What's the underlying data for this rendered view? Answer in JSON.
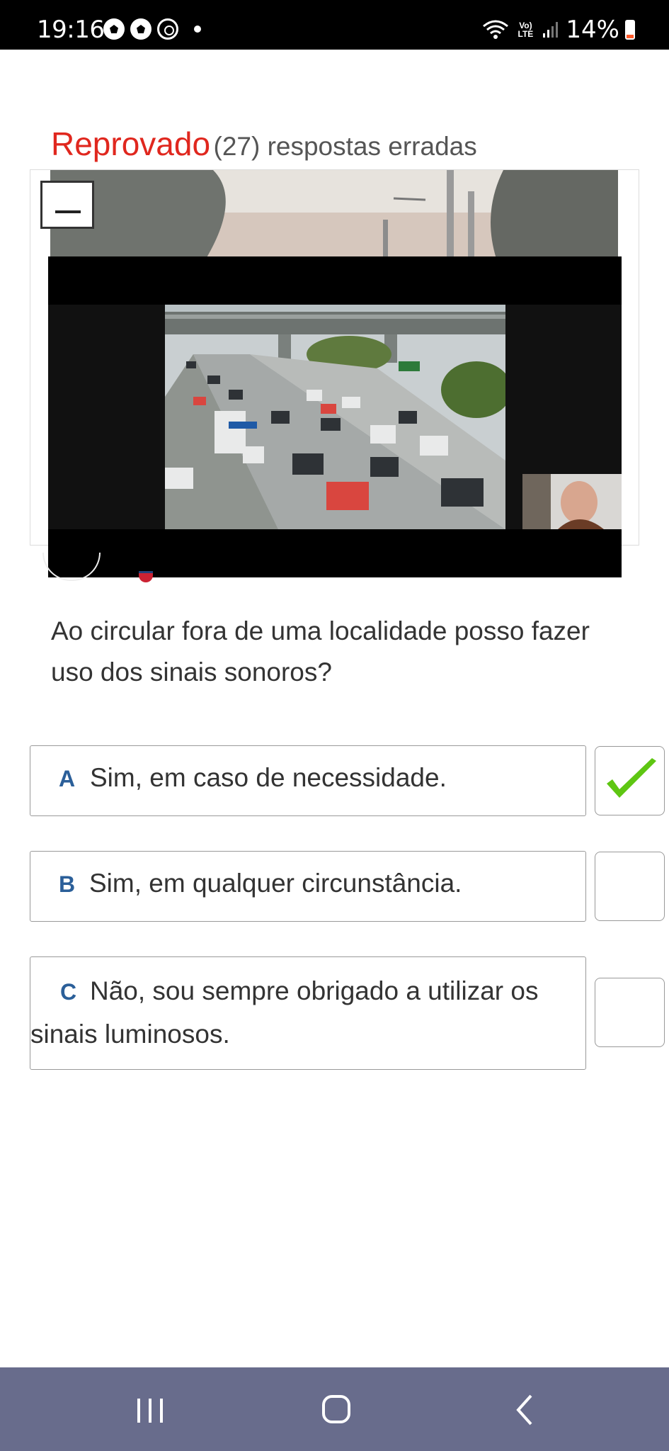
{
  "status_bar": {
    "time": "19:16",
    "battery": "14%",
    "network_label": "Vo) LTE",
    "icons": [
      "soccer-ball-icon",
      "soccer-ball-icon",
      "whatsapp-icon",
      "notification-dot-icon",
      "wifi-icon",
      "volte-icon",
      "signal-icon",
      "battery-icon"
    ]
  },
  "result": {
    "status": "Reprovado",
    "count": "(27) respostas erradas"
  },
  "question": {
    "text": "Ao circular fora de uma localidade posso fazer uso dos sinais sonoros?"
  },
  "answers": [
    {
      "letter": "A",
      "text": "Sim, em caso de necessidade.",
      "checked": true
    },
    {
      "letter": "B",
      "text": "Sim, em qualquer circunstância.",
      "checked": false
    },
    {
      "letter": "C",
      "text": "Não, sou sempre obrigado a utilizar os sinais luminosos.",
      "checked": false
    }
  ],
  "colors": {
    "fail_red": "#e0271e",
    "letter_blue": "#2b5f99",
    "check_green": "#5ec612",
    "nav_bar": "#686c8c"
  },
  "nav_bar": {
    "buttons": [
      "recent-apps-icon",
      "home-icon",
      "back-icon"
    ]
  }
}
